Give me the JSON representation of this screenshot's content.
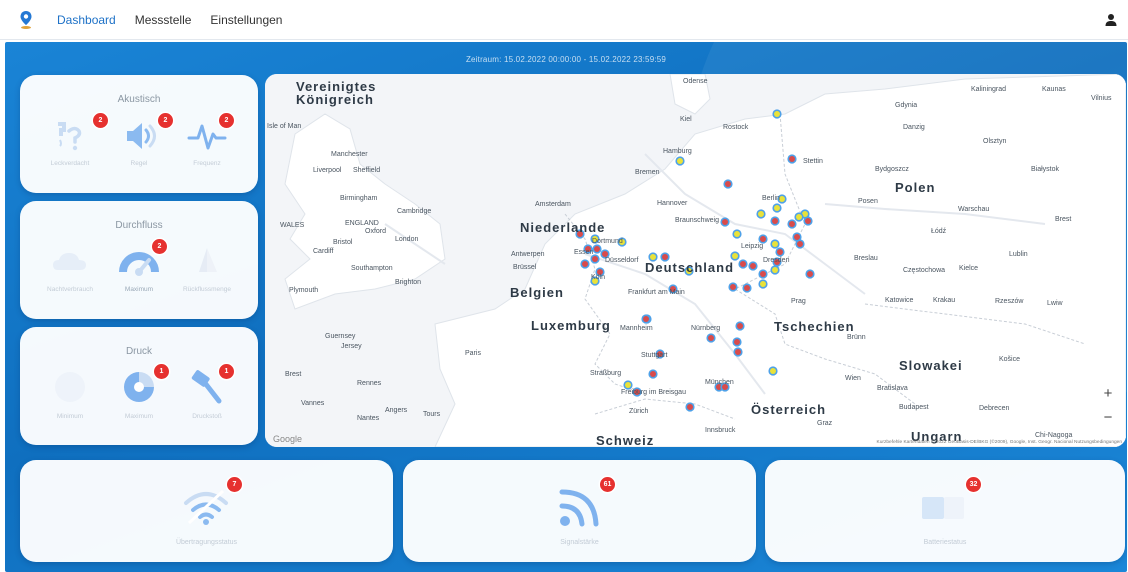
{
  "nav": {
    "tabs": [
      {
        "label": "Dashboard",
        "active": true
      },
      {
        "label": "Messstelle",
        "active": false
      },
      {
        "label": "Einstellungen",
        "active": false
      }
    ],
    "logo_icon": "map-pin-logo-icon",
    "user_icon": "user-icon"
  },
  "period": "Zeitraum: 15.02.2022 00:00:00 - 15.02.2022 23:59:59",
  "cards": {
    "akustisch": {
      "title": "Akustisch",
      "items": [
        {
          "label": "Leckverdacht",
          "badge": "2",
          "icon": "leak-question-icon"
        },
        {
          "label": "Regel",
          "badge": "2",
          "icon": "speaker-icon"
        },
        {
          "label": "Frequenz",
          "badge": "2",
          "icon": "pulse-icon"
        }
      ]
    },
    "durchfluss": {
      "title": "Durchfluss",
      "items": [
        {
          "label": "Nachtverbrauch",
          "badge": "",
          "icon": "cloud-icon"
        },
        {
          "label": "Maximum",
          "badge": "2",
          "icon": "gauge-icon"
        },
        {
          "label": "Rückflussmenge",
          "badge": "",
          "icon": "sail-icon"
        }
      ]
    },
    "druck": {
      "title": "Druck",
      "items": [
        {
          "label": "Minimum",
          "badge": "",
          "icon": "gauge-low-icon"
        },
        {
          "label": "Maximum",
          "badge": "1",
          "icon": "gauge-high-icon"
        },
        {
          "label": "Druckstoß",
          "badge": "1",
          "icon": "hammer-icon"
        }
      ]
    }
  },
  "map": {
    "countries": [
      "Vereinigtes",
      "Königreich",
      "Niederlande",
      "Belgien",
      "Luxemburg",
      "Deutschland",
      "Polen",
      "Tschechien",
      "Slowakei",
      "Österreich",
      "Schweiz",
      "Ungarn"
    ],
    "cities": [
      "Isle of Man",
      "Manchester",
      "Liverpool",
      "Sheffield",
      "Birmingham",
      "WALES",
      "ENGLAND",
      "London",
      "Cambridge",
      "Oxford",
      "Bristol",
      "Cardiff",
      "Southampton",
      "Brighton",
      "Plymouth",
      "Guernsey",
      "Jersey",
      "Paris",
      "Rennes",
      "Nantes",
      "Angers",
      "Tours",
      "Brest",
      "Vannes",
      "Amsterdam",
      "Antwerpen",
      "Brüssel",
      "Hamburg",
      "Bremen",
      "Hannover",
      "Braunschweig",
      "Kiel",
      "Rostock",
      "Berlin",
      "Leipzig",
      "Dresden",
      "Dortmund",
      "Essen",
      "Düsseldorf",
      "Köln",
      "Frankfurt am Main",
      "Mannheim",
      "Nürnberg",
      "Stuttgart",
      "Straßburg",
      "Freiburg im Breisgau",
      "Zürich",
      "München",
      "Innsbruck",
      "Graz",
      "Wien",
      "Bratislava",
      "Budapest",
      "Prag",
      "Brünn",
      "Stettin",
      "Gdynia",
      "Danzig",
      "Olsztyn",
      "Bydgoszcz",
      "Posen",
      "Warschau",
      "Łódź",
      "Lublin",
      "Breslau",
      "Częstochowa",
      "Kielce",
      "Katowice",
      "Krakau",
      "Kaunas",
      "Vilnius",
      "Białystok",
      "Brest",
      "Lwiw",
      "Kaliningrad",
      "Košice",
      "Debrecen",
      "Chi-Nagoga",
      "Odense",
      "Rzeszów"
    ],
    "google_label": "Google",
    "footer": "Kurzbefehle   Kartendaten © 2022 GeoBasis-DE/BKG (©2009), Google, Inst. Geogr. Nacional   Nutzungsbedingungen",
    "zoom_in": "+",
    "zoom_out": "−",
    "marker_colors": {
      "alert": "#d94b4b",
      "ok": "#e9e23a",
      "ring": "#4ea1e8"
    }
  },
  "bottom": [
    {
      "label": "Übertragungsstatus",
      "badge": "7",
      "icon": "wifi-off-icon"
    },
    {
      "label": "Signalstärke",
      "badge": "61",
      "icon": "signal-icon"
    },
    {
      "label": "Batteriestatus",
      "badge": "32",
      "icon": "battery-icon"
    }
  ],
  "colors": {
    "accent": "#1d71c7",
    "badge": "#e6312f",
    "icon": "#7fb2ee",
    "icon_light": "#c9dcf3"
  }
}
